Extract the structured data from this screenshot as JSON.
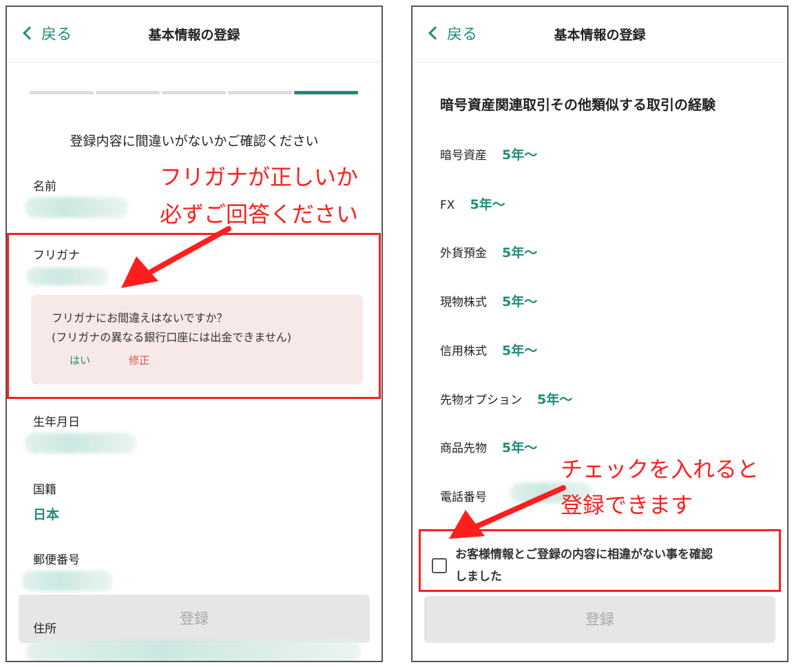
{
  "left": {
    "header": {
      "back_label": "戻る",
      "title": "基本情報の登録"
    },
    "progress": {
      "total_steps": 5,
      "current_step": 5
    },
    "confirm_heading": "登録内容に間違いがないかご確認ください",
    "fields": {
      "name_label": "名前",
      "furigana_label": "フリガナ",
      "birth_label": "生年月日",
      "nationality_label": "国籍",
      "nationality_value": "日本",
      "postal_label": "郵便番号",
      "address_label": "住所"
    },
    "furigana_alert": {
      "line1": "フリガナにお間違えはないですか？",
      "line2": "(フリガナの異なる銀行口座には出金できません)",
      "yes": "はい",
      "fix": "修正"
    },
    "annotation": {
      "line1": "フリガナが正しいか",
      "line2": "必ずご回答ください"
    },
    "register_button": "登録"
  },
  "right": {
    "header": {
      "back_label": "戻る",
      "title": "基本情報の登録"
    },
    "section_title": "暗号資産関連取引その他類似する取引の経験",
    "experience": [
      {
        "label": "暗号資産",
        "value": "5年〜"
      },
      {
        "label": "FX",
        "value": "5年〜"
      },
      {
        "label": "外貨預金",
        "value": "5年〜"
      },
      {
        "label": "現物株式",
        "value": "5年〜"
      },
      {
        "label": "信用株式",
        "value": "5年〜"
      },
      {
        "label": "先物オプション",
        "value": "5年〜"
      },
      {
        "label": "商品先物",
        "value": "5年〜"
      }
    ],
    "phone_label": "電話番号",
    "confirm_check": {
      "line1": "お客様情報とご登録の内容に相違がない事を確認",
      "line2": "しました",
      "checked": false
    },
    "annotation": {
      "line1": "チェックを入れると",
      "line2": "登録できます"
    },
    "register_button": "登録"
  },
  "colors": {
    "accent": "#1f8c79",
    "annotation": "#ff1e1e",
    "alert_bg": "#f7e9e7",
    "fix": "#e05040"
  }
}
